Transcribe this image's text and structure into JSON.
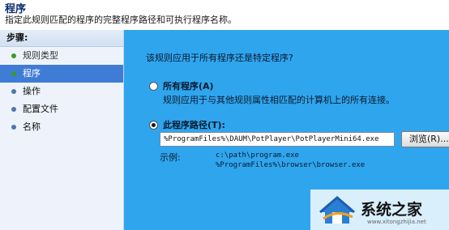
{
  "header": {
    "title": "程序",
    "description": "指定此规则匹配的程序的完整程序路径和可执行程序名称。"
  },
  "sidebar": {
    "steps_label": "步骤:",
    "items": [
      {
        "label": "规则类型",
        "state": "done"
      },
      {
        "label": "程序",
        "state": "active"
      },
      {
        "label": "操作",
        "state": "pending"
      },
      {
        "label": "配置文件",
        "state": "pending"
      },
      {
        "label": "名称",
        "state": "pending"
      }
    ]
  },
  "main": {
    "question": "该规则应用于所有程序还是特定程序?",
    "all_programs": {
      "label": "所有程序(A)",
      "description": "规则应用于与其他规则属性相匹配的计算机上的所有连接。",
      "selected": false
    },
    "this_program": {
      "label": "此程序路径(T):",
      "selected": true,
      "path_value": "%ProgramFiles%\\DAUM\\PotPlayer\\PotPlayerMini64.exe",
      "browse_label": "浏览(R)...",
      "example_label": "示例:",
      "example_lines": [
        "c:\\path\\program.exe",
        "%ProgramFiles%\\browser\\browser.exe"
      ]
    }
  },
  "watermark": {
    "brand": "系统之家",
    "url": "www.xitongzhijia.net"
  },
  "colors": {
    "main_bg": "#2fa5ee",
    "sidebar_bg": "#eef3fb",
    "active_step": "#3f7cd6",
    "title": "#0b2d6e"
  }
}
